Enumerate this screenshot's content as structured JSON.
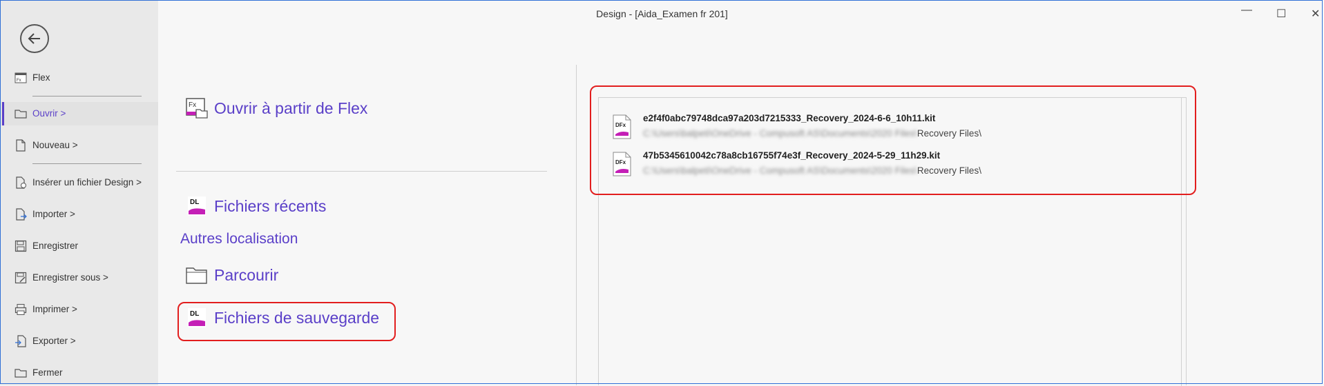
{
  "window": {
    "title": "Design - [Aida_Examen fr 201]",
    "controls": {
      "minimize": "—",
      "maximize": "☐",
      "close": "✕"
    }
  },
  "sidebar": {
    "items": [
      {
        "label": "Flex",
        "icon": "flex-icon"
      },
      {
        "label": "Ouvrir >",
        "icon": "folder-open-icon",
        "active": true
      },
      {
        "label": "Nouveau >",
        "icon": "new-document-icon"
      },
      {
        "label": "Insérer un fichier Design >",
        "icon": "insert-file-icon"
      },
      {
        "label": "Importer >",
        "icon": "import-icon"
      },
      {
        "label": "Enregistrer",
        "icon": "save-icon"
      },
      {
        "label": "Enregistrer sous >",
        "icon": "save-as-icon"
      },
      {
        "label": "Imprimer >",
        "icon": "printer-icon"
      },
      {
        "label": "Exporter >",
        "icon": "export-icon"
      },
      {
        "label": "Fermer",
        "icon": "close-folder-icon"
      }
    ]
  },
  "open_options": {
    "from_flex": "Ouvrir à partir de Flex",
    "recent_files": "Fichiers récents",
    "other_locations": "Autres localisation",
    "browse": "Parcourir",
    "backup_files": "Fichiers de sauvegarde"
  },
  "files": [
    {
      "name": "e2f4f0abc79748dca97a203d7215333_Recovery_2024-6-6_10h11.kit",
      "path_hidden": "C:\\Users\\balpeti\\OneDrive - Compusoft AS\\Documents\\2020 Files\\",
      "path_visible": "Recovery Files\\"
    },
    {
      "name": "47b5345610042c78a8cb16755f74e3f_Recovery_2024-5-29_11h29.kit",
      "path_hidden": "C:\\Users\\balpeti\\OneDrive - Compusoft AS\\Documents\\2020 Files\\",
      "path_visible": "Recovery Files\\"
    }
  ],
  "colors": {
    "accent": "#5a3fc8",
    "highlight": "#e21d1d",
    "sidebar_bg": "#e9e9e9",
    "icon_magenta": "#c41fb6"
  }
}
